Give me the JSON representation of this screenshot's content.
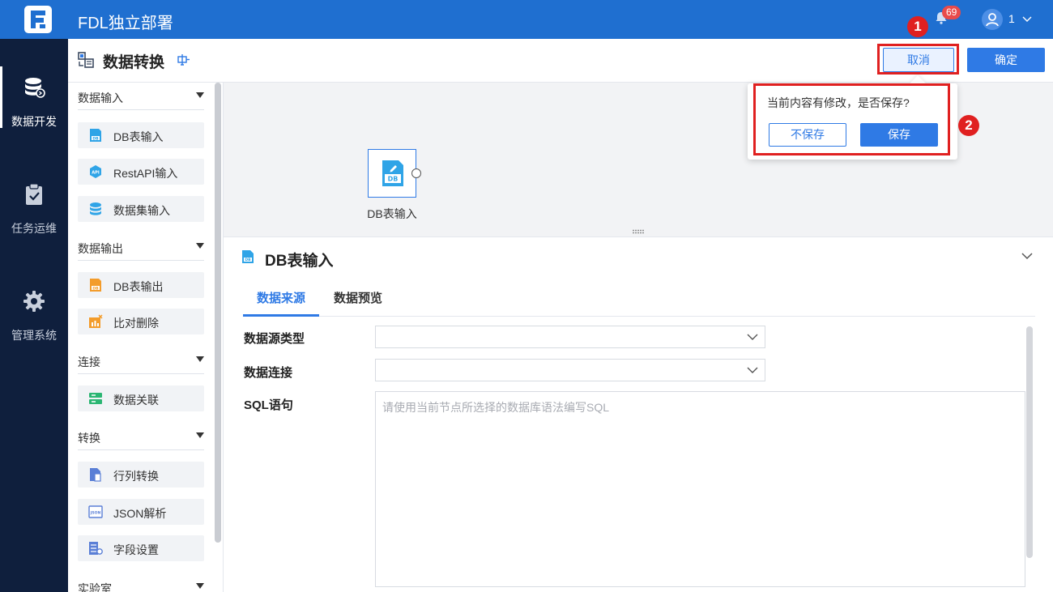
{
  "topbar": {
    "title": "FDL独立部署",
    "notification_count": "69",
    "user_name": "1",
    "icons": [
      "fdl-logo-icon",
      "bell-icon",
      "user-avatar-icon",
      "chevron-down-icon"
    ]
  },
  "nav": {
    "items": [
      {
        "label": "数据开发",
        "icon": "database-icon",
        "active": true
      },
      {
        "label": "任务运维",
        "icon": "clipboard-check-icon",
        "active": false
      },
      {
        "label": "管理系统",
        "icon": "gear-icon",
        "active": false
      }
    ]
  },
  "header": {
    "title": "数据转换",
    "cancel_label": "取消",
    "ok_label": "确定"
  },
  "popover": {
    "message": "当前内容有修改，是否保存?",
    "nosave_label": "不保存",
    "save_label": "保存"
  },
  "annotations": {
    "first": "1",
    "second": "2",
    "color": "#e02020"
  },
  "panel": {
    "groups": [
      {
        "label": "数据输入",
        "items": [
          {
            "label": "DB表输入",
            "icon": "db-input-icon"
          },
          {
            "label": "RestAPI输入",
            "icon": "api-icon"
          },
          {
            "label": "数据集输入",
            "icon": "dataset-icon"
          }
        ]
      },
      {
        "label": "数据输出",
        "items": [
          {
            "label": "DB表输出",
            "icon": "db-output-icon"
          },
          {
            "label": "比对删除",
            "icon": "compare-delete-icon"
          }
        ]
      },
      {
        "label": "连接",
        "items": [
          {
            "label": "数据关联",
            "icon": "data-join-icon"
          }
        ]
      },
      {
        "label": "转换",
        "items": [
          {
            "label": "行列转换",
            "icon": "row-column-icon"
          },
          {
            "label": "JSON解析",
            "icon": "json-icon"
          },
          {
            "label": "字段设置",
            "icon": "field-settings-icon"
          }
        ]
      },
      {
        "label": "实验室",
        "items": []
      }
    ]
  },
  "canvas": {
    "node_label": "DB表输入",
    "node_icon_text": "DB"
  },
  "detail": {
    "title": "DB表输入",
    "tabs": [
      "数据来源",
      "数据预览"
    ],
    "fields": {
      "datasource_type_label": "数据源类型",
      "datasource_type_value": "",
      "connection_label": "数据连接",
      "connection_value": "",
      "sql_label": "SQL语句",
      "sql_placeholder": "请使用当前节点所选择的数据库语法编写SQL"
    }
  },
  "colors": {
    "brand_blue": "#1f6fd0",
    "primary": "#2f7ae5",
    "nav_bg": "#0f1f3d",
    "canvas_bg": "#f2f3f5"
  }
}
